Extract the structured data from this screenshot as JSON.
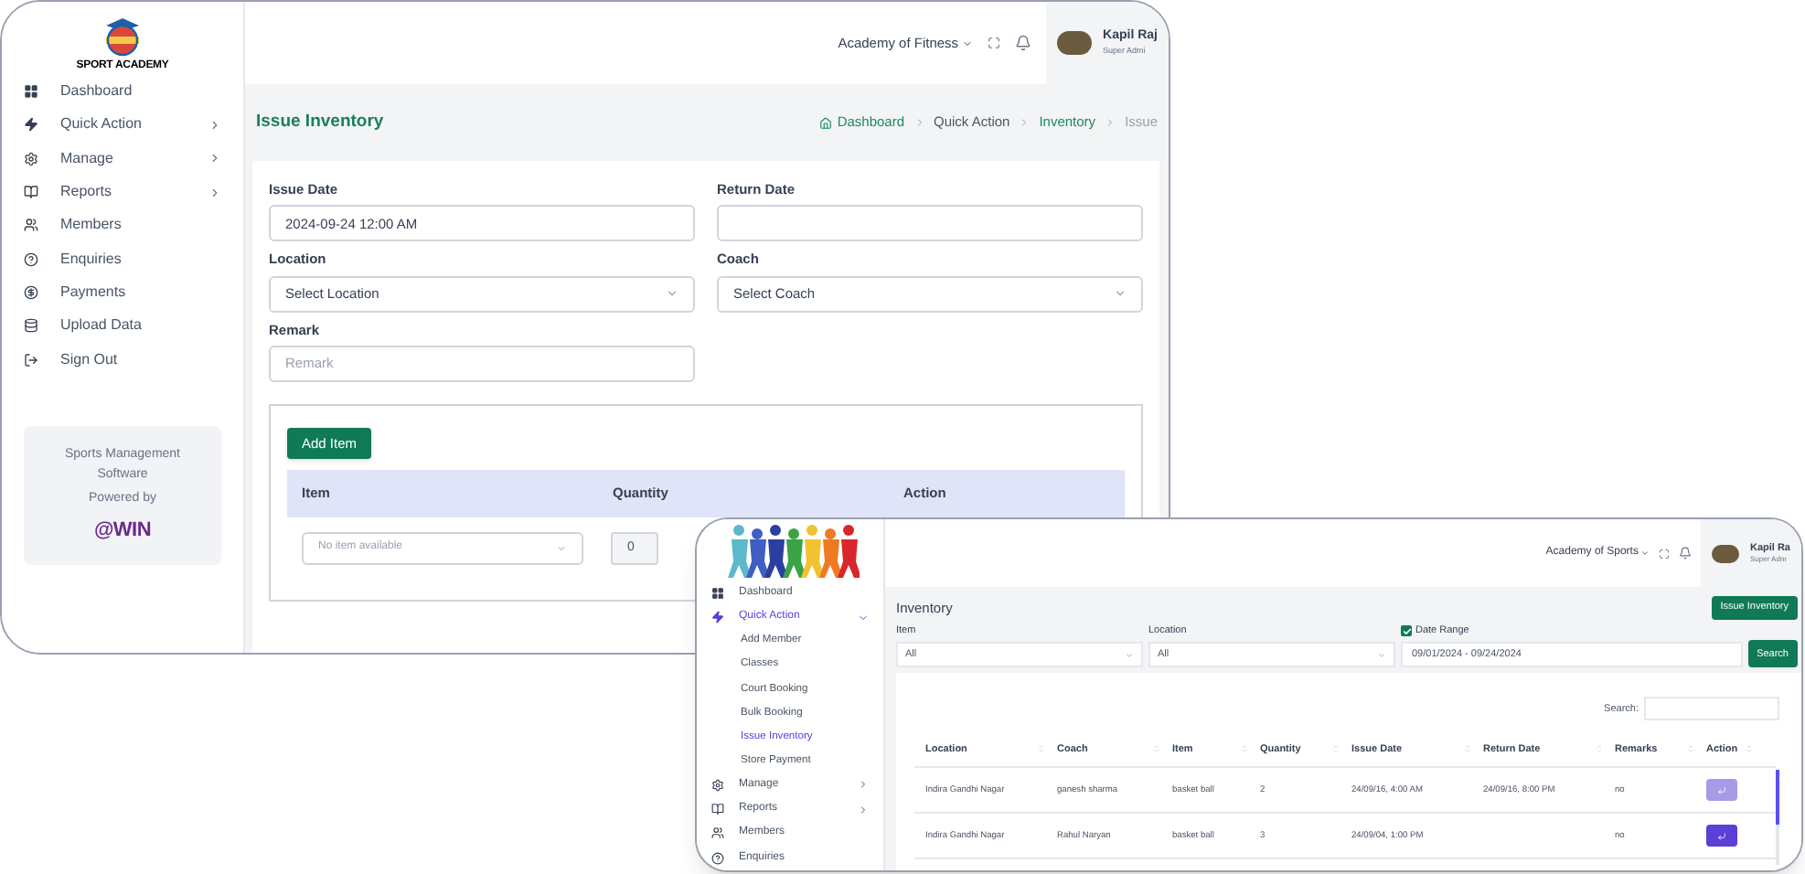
{
  "main_window": {
    "logo_text": "SPORT ACADEMY",
    "nav": [
      {
        "label": "Dashboard",
        "has_submenu": false
      },
      {
        "label": "Quick Action",
        "has_submenu": true
      },
      {
        "label": "Manage",
        "has_submenu": true
      },
      {
        "label": "Reports",
        "has_submenu": true
      },
      {
        "label": "Members",
        "has_submenu": false
      },
      {
        "label": "Enquiries",
        "has_submenu": false
      },
      {
        "label": "Payments",
        "has_submenu": false
      },
      {
        "label": "Upload Data",
        "has_submenu": false
      },
      {
        "label": "Sign Out",
        "has_submenu": false
      }
    ],
    "promo": {
      "text": "Sports Management Software",
      "powered_by": "Powered by",
      "brand": "@WIN"
    },
    "header": {
      "academy": "Academy of Fitness",
      "user_name": "Kapil Raj",
      "user_role": "Super Admi"
    },
    "page_title": "Issue Inventory",
    "breadcrumb": [
      {
        "label": "Dashboard",
        "kind": "home"
      },
      {
        "label": "Quick Action",
        "kind": "text"
      },
      {
        "label": "Inventory",
        "kind": "link"
      },
      {
        "label": "Issue",
        "kind": "current"
      }
    ],
    "form_fields": [
      {
        "label": "Issue Date",
        "kind": "input",
        "value": "2024-09-24 12:00 AM"
      },
      {
        "label": "Return Date",
        "kind": "input"
      },
      {
        "label": "Location",
        "kind": "select",
        "placeholder": "Select Location"
      },
      {
        "label": "Coach",
        "kind": "select",
        "placeholder": "Select Coach"
      },
      {
        "label": "Remark",
        "kind": "input",
        "placeholder": "Remark"
      }
    ],
    "items_section": {
      "button": "Add Item",
      "columns": [
        "Item",
        "Quantity",
        "Action"
      ],
      "row": {
        "item_placeholder": "No item available",
        "quantity": "0"
      }
    }
  },
  "overlay_window": {
    "nav": [
      {
        "label": "Dashboard",
        "selected": false
      },
      {
        "label": "Quick Action",
        "selected": true,
        "expanded": true,
        "children": [
          {
            "label": "Add Member",
            "selected": false
          },
          {
            "label": "Classes",
            "selected": false
          },
          {
            "label": "Court Booking",
            "selected": false
          },
          {
            "label": "Bulk Booking",
            "selected": false
          },
          {
            "label": "Issue Inventory",
            "selected": true
          },
          {
            "label": "Store Payment",
            "selected": false
          }
        ]
      },
      {
        "label": "Manage",
        "selected": false,
        "expanded": false
      },
      {
        "label": "Reports",
        "selected": false,
        "expanded": false
      },
      {
        "label": "Members",
        "selected": false
      },
      {
        "label": "Enquiries",
        "selected": false
      }
    ],
    "header": {
      "academy": "Academy of Sports",
      "user_name": "Kapil Ra",
      "user_role": "Super Adm"
    },
    "page_title": "Inventory",
    "issue_button": "Issue Inventory",
    "filters": [
      {
        "label": "Item",
        "value": "All"
      },
      {
        "label": "Location",
        "value": "All"
      }
    ],
    "date_range": {
      "label": "Date Range",
      "checked": true,
      "value": "09/01/2024 - 09/24/2024"
    },
    "search_button": "Search",
    "table": {
      "search_label": "Search:",
      "columns": [
        "Location",
        "Coach",
        "Item",
        "Quantity",
        "Issue Date",
        "Return Date",
        "Remarks",
        "Action"
      ],
      "rows": [
        {
          "cells": [
            "Indira Gandhi Nagar",
            "ganesh sharma",
            "basket ball",
            "2",
            "24/09/16, 4:00 AM",
            "24/09/16, 8:00 PM",
            "no"
          ],
          "disabled": true
        },
        {
          "cells": [
            "Indira Gandhi Nagar",
            "Rahul Naryan",
            "basket ball",
            "3",
            "24/09/04, 1:00 PM",
            "",
            "no"
          ],
          "disabled": false
        }
      ]
    }
  }
}
